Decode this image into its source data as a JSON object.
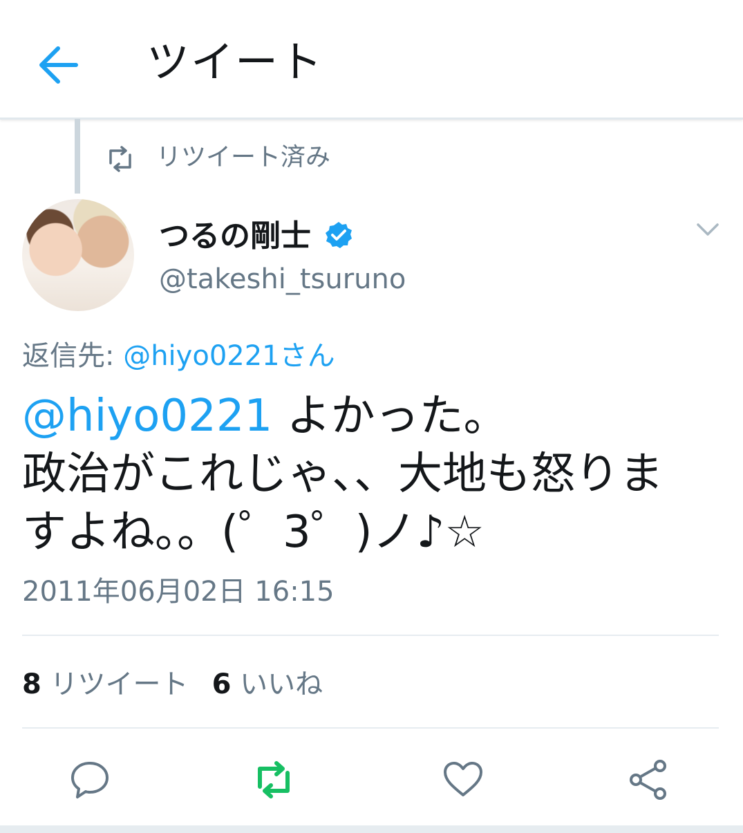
{
  "header": {
    "title": "ツイート"
  },
  "retweet_banner": {
    "label": "リツイート済み"
  },
  "tweet": {
    "author": {
      "display_name": "つるの剛士",
      "handle": "@takeshi_tsuruno",
      "verified": true
    },
    "reply_to": {
      "prefix": "返信先:",
      "user": "@hiyo0221さん"
    },
    "text": {
      "mention": "@hiyo0221",
      "line1_rest": " よかった。",
      "line2": "政治がこれじゃ、、大地も怒りま",
      "line3": "すよね。。(゜3゜)ノ♪☆"
    },
    "timestamp": "2011年06月02日 16:15",
    "stats": {
      "retweets_count": "8",
      "retweets_label": "リツイート",
      "likes_count": "6",
      "likes_label": "いいね"
    }
  },
  "icons": {
    "back": "arrow-left-icon",
    "retweeted": "retweet-icon",
    "verified": "verified-badge-icon",
    "menu": "chevron-down-icon",
    "reply": "reply-icon",
    "retweet": "retweet-icon",
    "like": "heart-icon",
    "share": "share-icon"
  },
  "colors": {
    "accent": "#1da1f2",
    "retweet_active": "#17bf63",
    "secondary_text": "#657786",
    "primary_text": "#14171a"
  }
}
